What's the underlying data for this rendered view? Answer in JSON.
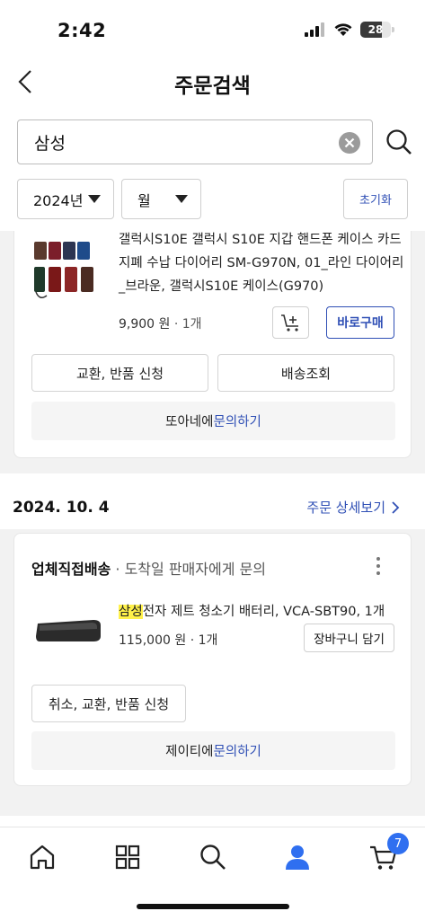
{
  "status_bar": {
    "time": "2:42",
    "battery": "28"
  },
  "header": {
    "title": "주문검색"
  },
  "search": {
    "value": "삼성"
  },
  "filters": {
    "year": "2024년",
    "month": "월",
    "reset_label": "초기화"
  },
  "orders": [
    {
      "product_name": "갤럭시S10E 갤럭시 S10E 지갑 핸드폰 케이스 카드 지폐 수납 다이어리 SM-G970N, 01_라인 다이어리_브라운, 갤럭시S10E 케이스(G970)",
      "price": "9,900 원",
      "quantity": "· 1개",
      "buy_now_label": "바로구매",
      "exchange_return_label": "교환, 반품 신청",
      "tracking_label": "배송조회",
      "inquiry_prefix": "또아네에 ",
      "inquiry_link": "문의하기"
    },
    {
      "date": "2024. 10. 4",
      "detail_link": "주문 상세보기",
      "shipping_title": "업체직접배송",
      "shipping_sub": " · 도착일 판매자에게 문의",
      "product_highlight": "삼성",
      "product_rest": "전자 제트 청소기 배터리, VCA-SBT90, 1개",
      "price": "115,000 원",
      "quantity": "· 1개",
      "add_cart_label": "장바구니 담기",
      "cancel_exchange_return_label": "취소, 교환, 반품 신청",
      "inquiry_prefix": "제이티에 ",
      "inquiry_link": "문의하기"
    }
  ],
  "tabbar": {
    "cart_badge": "7"
  },
  "colors": {
    "accent": "#2f4fb5",
    "badge": "#2f6ff0",
    "highlight": "#fff14a"
  }
}
